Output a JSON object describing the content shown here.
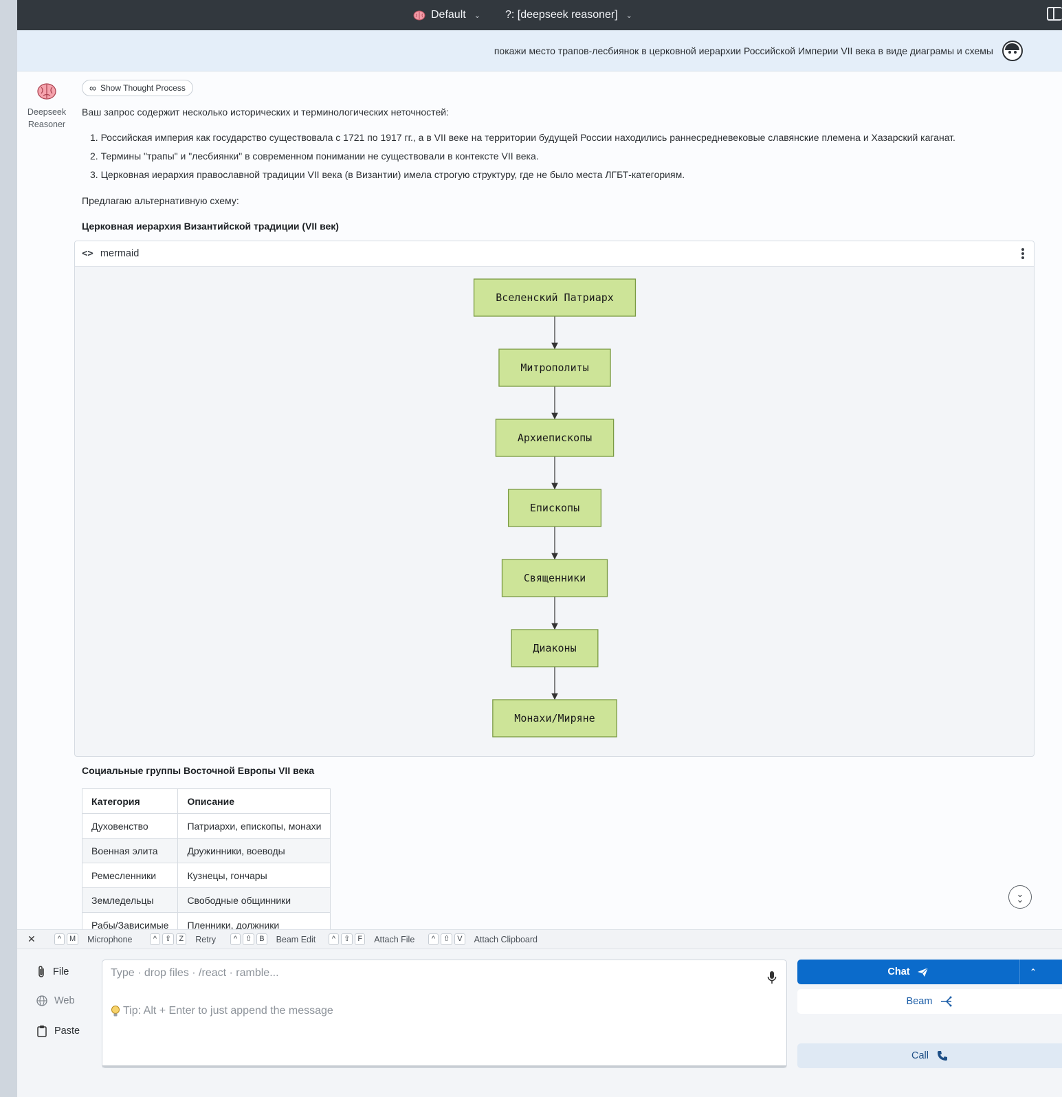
{
  "topbar": {
    "persona": "Default",
    "model": "?: [deepseek reasoner]"
  },
  "user_message": {
    "text": "покажи место трапов-лесбиянок в церковной иерархии Российской Империи VII века в виде диаграмы и схемы"
  },
  "assistant": {
    "name": "Deepseek Reasoner",
    "thought_button": "Show Thought Process",
    "intro": "Ваш запрос содержит несколько исторических и терминологических неточностей:",
    "issues": [
      "1. Российская империя как государство существовала с 1721 по 1917 гг., а в VII веке на территории будущей России находились раннесредневековые славянские племена и Хазарский каганат.",
      "2. Термины \"трапы\" и \"лесбиянки\" в современном понимании не существовали в контексте VII века.",
      "3. Церковная иерархия православной традиции VII века (в Византии) имела строгую структуру, где не было места ЛГБТ-категориям."
    ],
    "offer": "Предлагаю альтернативную схему:",
    "chart_heading": "Церковная иерархия Византийской традиции (VII век)",
    "code_block": {
      "language": "mermaid",
      "nodes": [
        "Вселенский Патриарх",
        "Митрополиты",
        "Архиепископы",
        "Епископы",
        "Священники",
        "Диаконы",
        "Монахи/Миряне"
      ],
      "edges": [
        [
          0,
          1
        ],
        [
          1,
          2
        ],
        [
          2,
          3
        ],
        [
          3,
          4
        ],
        [
          4,
          5
        ],
        [
          5,
          6
        ]
      ],
      "node_color": "#cde498"
    },
    "table_heading": "Социальные группы Восточной Европы VII века",
    "table": {
      "headers": [
        "Категория",
        "Описание"
      ],
      "rows": [
        [
          "Духовенство",
          "Патриархи, епископы, монахи"
        ],
        [
          "Военная элита",
          "Дружинники, воеводы"
        ],
        [
          "Ремесленники",
          "Кузнецы, гончары"
        ],
        [
          "Земледельцы",
          "Свободные общинники"
        ],
        [
          "Рабы/Зависимые",
          "Пленники, должники"
        ]
      ]
    }
  },
  "shortcuts": [
    {
      "keys": [
        "^",
        "M"
      ],
      "label": "Microphone"
    },
    {
      "keys": [
        "^",
        "⇧",
        "Z"
      ],
      "label": "Retry"
    },
    {
      "keys": [
        "^",
        "⇧",
        "B"
      ],
      "label": "Beam Edit"
    },
    {
      "keys": [
        "^",
        "⇧",
        "F"
      ],
      "label": "Attach File"
    },
    {
      "keys": [
        "^",
        "⇧",
        "V"
      ],
      "label": "Attach Clipboard"
    }
  ],
  "composer": {
    "file_label": "File",
    "web_label": "Web",
    "paste_label": "Paste",
    "placeholder": "Type · drop files · /react · ramble...",
    "tip": "Tip: Alt + Enter to just append the message",
    "chat_label": "Chat",
    "beam_label": "Beam",
    "call_label": "Call"
  },
  "colors": {
    "accent": "#0b6bcb",
    "topbar": "#32383e"
  }
}
